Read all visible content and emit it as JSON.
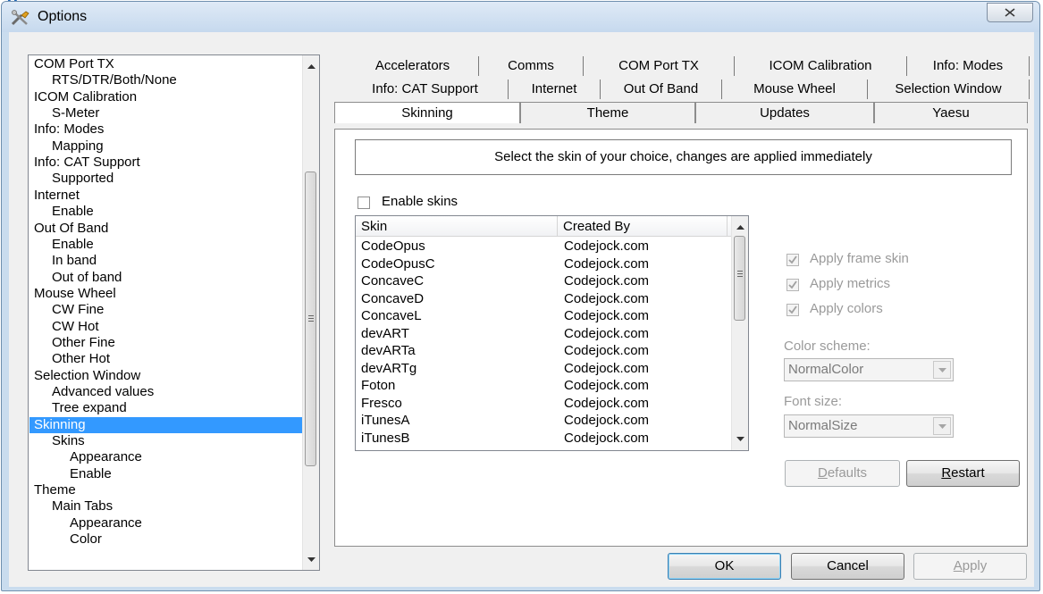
{
  "window": {
    "title": "Options"
  },
  "tree": {
    "items": [
      {
        "label": "COM Port TX",
        "level": 0,
        "selected": false
      },
      {
        "label": "RTS/DTR/Both/None",
        "level": 1,
        "selected": false
      },
      {
        "label": "ICOM Calibration",
        "level": 0,
        "selected": false
      },
      {
        "label": "S-Meter",
        "level": 1,
        "selected": false
      },
      {
        "label": "Info: Modes",
        "level": 0,
        "selected": false
      },
      {
        "label": "Mapping",
        "level": 1,
        "selected": false
      },
      {
        "label": "Info: CAT Support",
        "level": 0,
        "selected": false
      },
      {
        "label": "Supported",
        "level": 1,
        "selected": false
      },
      {
        "label": "Internet",
        "level": 0,
        "selected": false
      },
      {
        "label": "Enable",
        "level": 1,
        "selected": false
      },
      {
        "label": "Out Of Band",
        "level": 0,
        "selected": false
      },
      {
        "label": "Enable",
        "level": 1,
        "selected": false
      },
      {
        "label": "In band",
        "level": 1,
        "selected": false
      },
      {
        "label": "Out of band",
        "level": 1,
        "selected": false
      },
      {
        "label": "Mouse Wheel",
        "level": 0,
        "selected": false
      },
      {
        "label": "CW Fine",
        "level": 1,
        "selected": false
      },
      {
        "label": "CW Hot",
        "level": 1,
        "selected": false
      },
      {
        "label": "Other Fine",
        "level": 1,
        "selected": false
      },
      {
        "label": "Other Hot",
        "level": 1,
        "selected": false
      },
      {
        "label": "Selection Window",
        "level": 0,
        "selected": false
      },
      {
        "label": "Advanced values",
        "level": 1,
        "selected": false
      },
      {
        "label": "Tree expand",
        "level": 1,
        "selected": false
      },
      {
        "label": "Skinning",
        "level": 0,
        "selected": true
      },
      {
        "label": "Skins",
        "level": 1,
        "selected": false
      },
      {
        "label": "Appearance",
        "level": 2,
        "selected": false
      },
      {
        "label": "Enable",
        "level": 2,
        "selected": false
      },
      {
        "label": "Theme",
        "level": 0,
        "selected": false
      },
      {
        "label": "Main Tabs",
        "level": 1,
        "selected": false
      },
      {
        "label": "Appearance",
        "level": 2,
        "selected": false
      },
      {
        "label": "Color",
        "level": 2,
        "selected": false
      }
    ]
  },
  "tabs": {
    "row1": [
      "Accelerators",
      "Comms",
      "COM Port TX",
      "ICOM Calibration",
      "Info: Modes"
    ],
    "row2": [
      "Info: CAT Support",
      "Internet",
      "Out Of Band",
      "Mouse Wheel",
      "Selection Window"
    ],
    "row3": [
      "Skinning",
      "Theme",
      "Updates",
      "Yaesu"
    ],
    "active": "Skinning"
  },
  "skinning": {
    "banner": "Select the skin of your choice, changes are applied immediately",
    "enable_skins_label": "Enable skins",
    "columns": [
      "Skin",
      "Created By"
    ],
    "rows": [
      [
        "CodeOpus",
        "Codejock.com"
      ],
      [
        "CodeOpusC",
        "Codejock.com"
      ],
      [
        "ConcaveC",
        "Codejock.com"
      ],
      [
        "ConcaveD",
        "Codejock.com"
      ],
      [
        "ConcaveL",
        "Codejock.com"
      ],
      [
        "devART",
        "Codejock.com"
      ],
      [
        "devARTa",
        "Codejock.com"
      ],
      [
        "devARTg",
        "Codejock.com"
      ],
      [
        "Foton",
        "Codejock.com"
      ],
      [
        "Fresco",
        "Codejock.com"
      ],
      [
        "iTunesA",
        "Codejock.com"
      ],
      [
        "iTunesB",
        "Codejock.com"
      ]
    ],
    "apply_frame_skin": "Apply frame skin",
    "apply_metrics": "Apply metrics",
    "apply_colors": "Apply colors",
    "color_scheme_label": "Color scheme:",
    "color_scheme_value": "NormalColor",
    "font_size_label": "Font size:",
    "font_size_value": "NormalSize",
    "defaults_button_pre": "",
    "defaults_button_key": "D",
    "defaults_button_post": "efaults",
    "restart_button_pre": "",
    "restart_button_key": "R",
    "restart_button_post": "estart"
  },
  "footer": {
    "ok": "OK",
    "cancel": "Cancel",
    "apply_key": "A",
    "apply_post": "pply"
  },
  "colors": {
    "selection": "#3399ff",
    "window_frame": "#c9dcee"
  }
}
